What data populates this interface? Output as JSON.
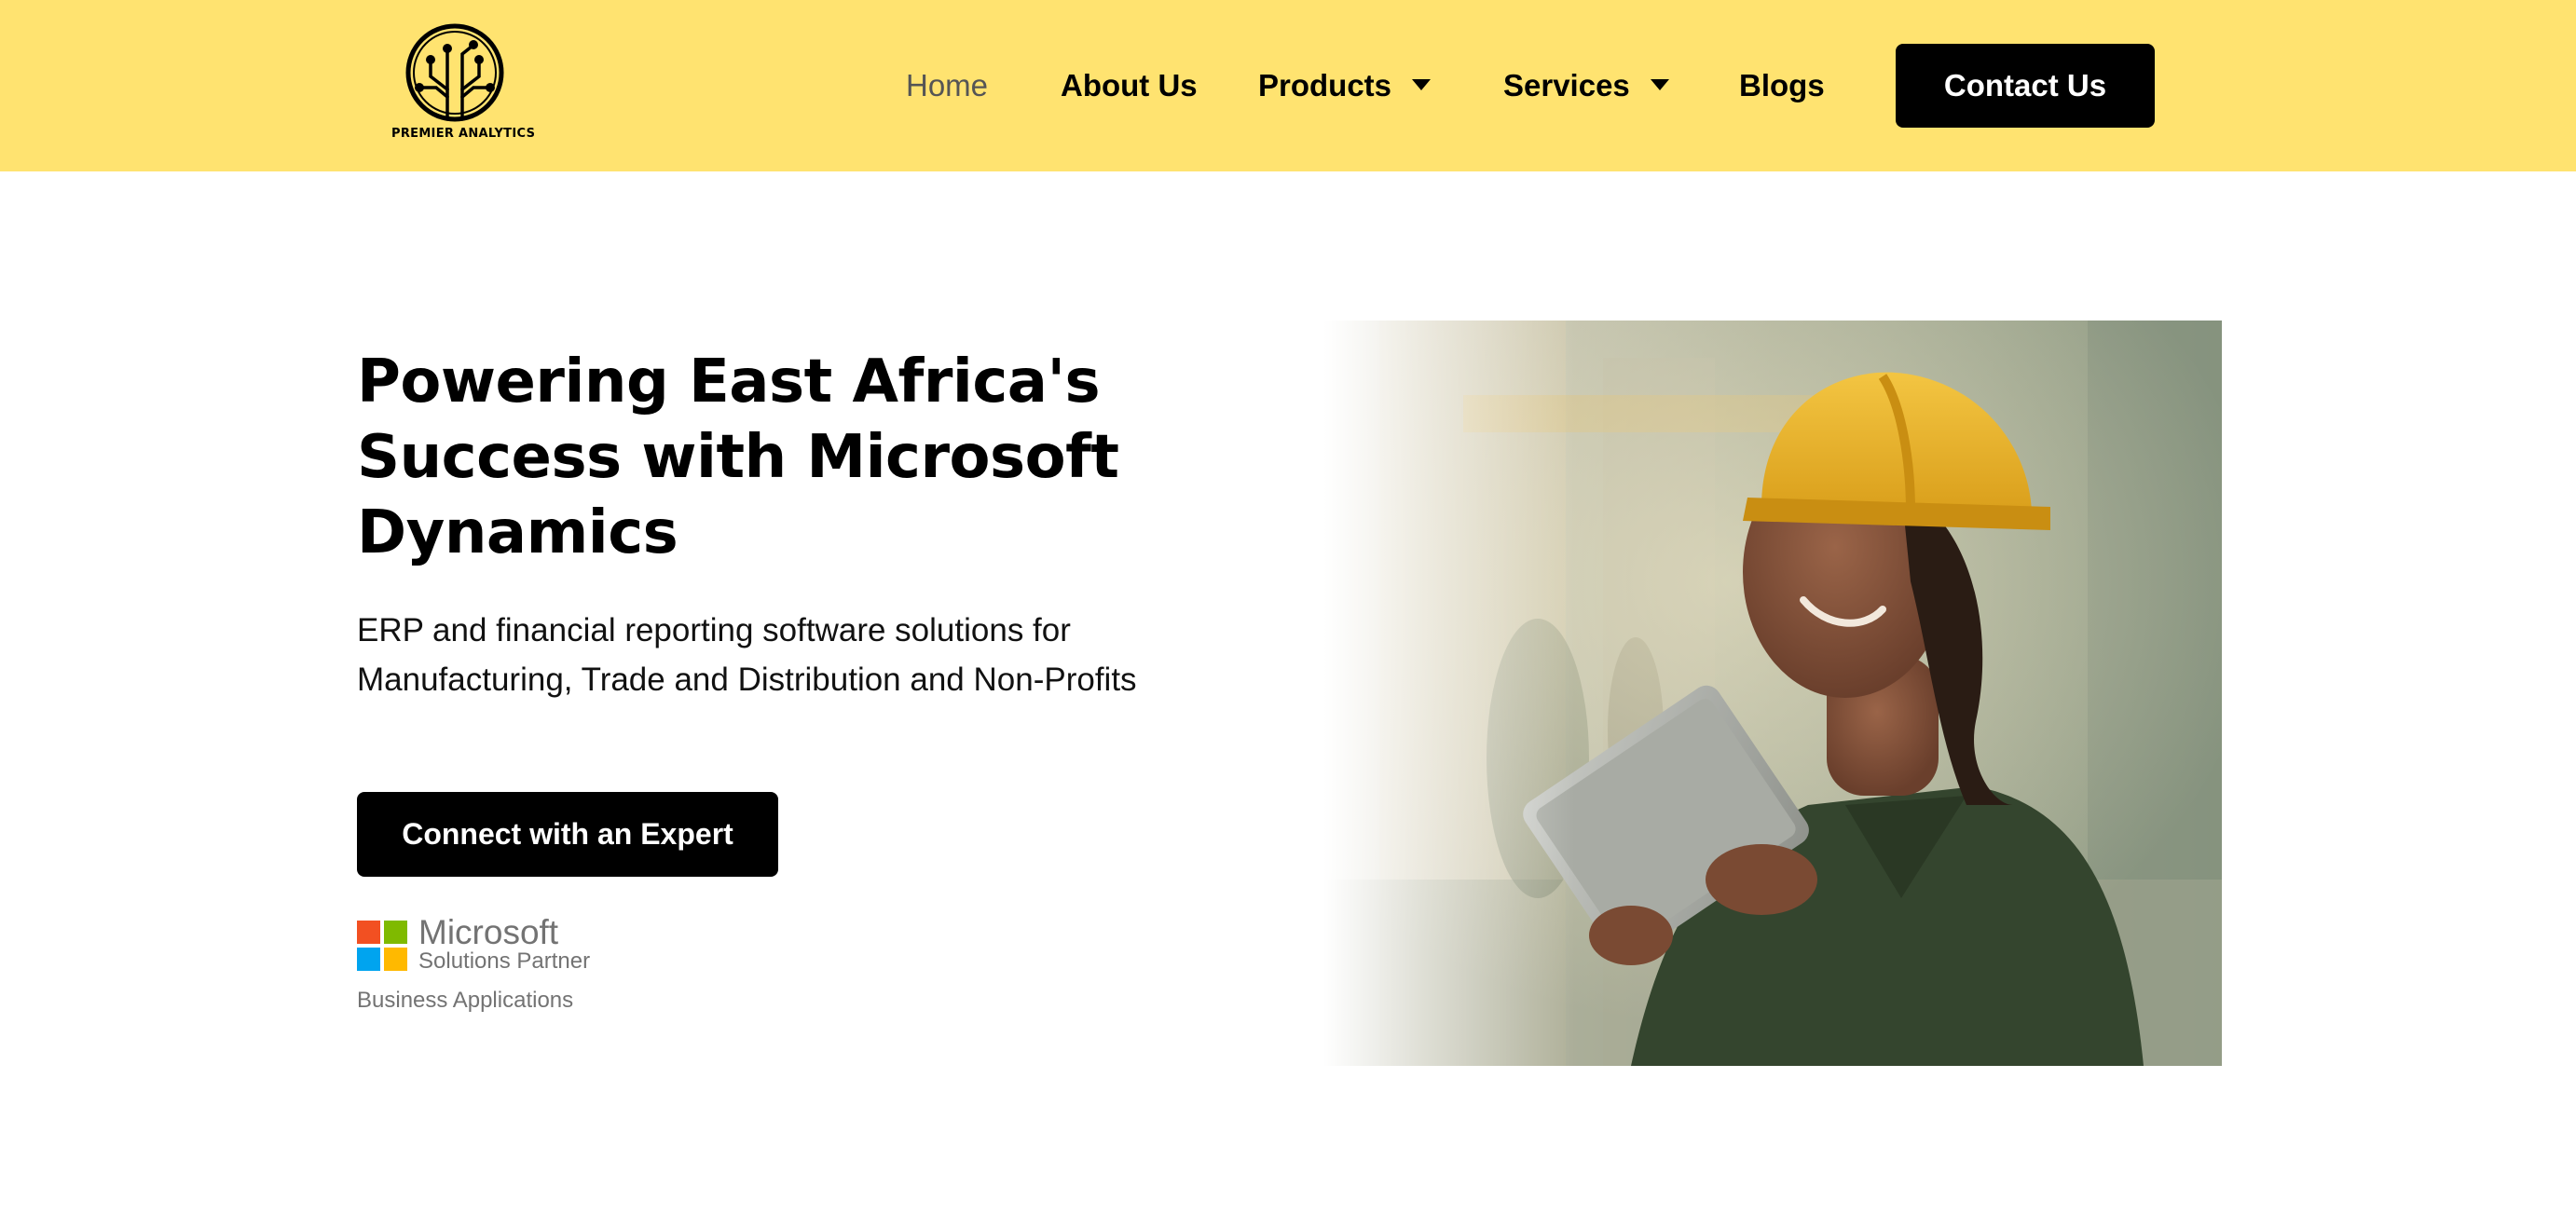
{
  "brand": {
    "name": "PREMIER ANALYTICS",
    "color": "#FFE370"
  },
  "nav": {
    "items": [
      {
        "label": "Home",
        "active": true
      },
      {
        "label": "About Us"
      },
      {
        "label": "Products",
        "dropdown": true
      },
      {
        "label": "Services",
        "dropdown": true
      },
      {
        "label": "Blogs"
      }
    ],
    "contact_label": "Contact Us"
  },
  "hero": {
    "title": "Powering East Africa's Success with Microsoft Dynamics",
    "subtitle_line1": "ERP and financial reporting software solutions for",
    "subtitle_line2": "Manufacturing, Trade and Distribution and Non-Profits",
    "cta_label": "Connect with an Expert",
    "badge": {
      "name": "Microsoft",
      "partner": "Solutions Partner",
      "category": "Business Applications",
      "colors": [
        "#F25022",
        "#7FBA00",
        "#00A4EF",
        "#FFB900"
      ]
    },
    "photo_icon": "worker-with-tablet-photo"
  }
}
